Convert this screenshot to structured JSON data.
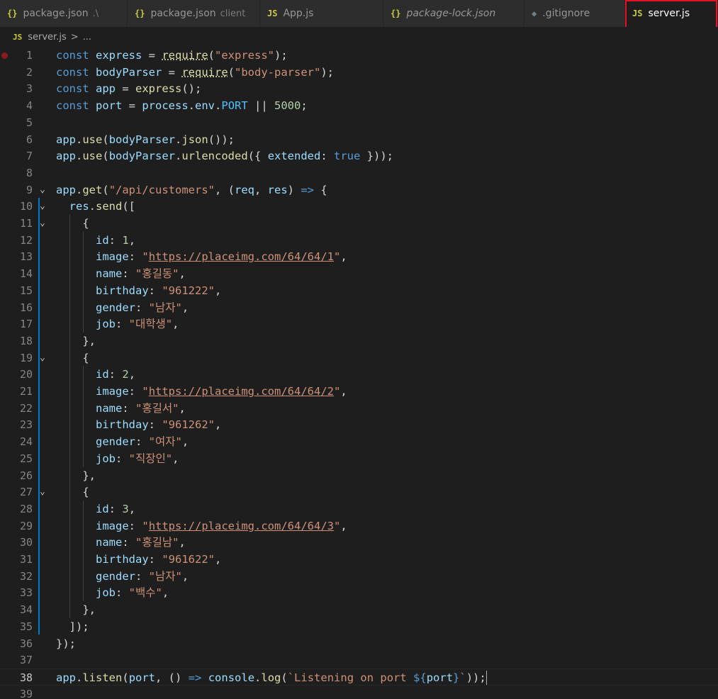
{
  "tabs": [
    {
      "icon": "{}",
      "icon_name": "json-icon",
      "label": "package.json",
      "desc": ".\\",
      "width": 180
    },
    {
      "icon": "{}",
      "icon_name": "json-icon",
      "label": "package.json",
      "desc": "client",
      "width": 187
    },
    {
      "icon": "JS",
      "icon_name": "js-icon",
      "label": "App.js",
      "desc": "",
      "width": 174
    },
    {
      "icon": "{}",
      "icon_name": "json-icon",
      "label": "package-lock.json",
      "desc": "",
      "width": 199,
      "italic": true
    },
    {
      "icon": "◆",
      "icon_name": "git-icon",
      "label": ".gitignore",
      "desc": "",
      "width": 142
    },
    {
      "icon": "JS",
      "icon_name": "js-icon",
      "label": "server.js",
      "desc": "",
      "width": 131,
      "active": true
    }
  ],
  "breadcrumb": {
    "icon": "JS",
    "file": "server.js",
    "separator": ">",
    "more": "..."
  },
  "editor": {
    "active_line": 38,
    "breakpoint_line": 1,
    "lines": [
      {
        "n": 1,
        "code": "const express = require(\"express\");"
      },
      {
        "n": 2,
        "code": "const bodyParser = require(\"body-parser\");"
      },
      {
        "n": 3,
        "code": "const app = express();"
      },
      {
        "n": 4,
        "code": "const port = process.env.PORT || 5000;"
      },
      {
        "n": 5,
        "code": ""
      },
      {
        "n": 6,
        "code": "app.use(bodyParser.json());"
      },
      {
        "n": 7,
        "code": "app.use(bodyParser.urlencoded({ extended: true }));"
      },
      {
        "n": 8,
        "code": ""
      },
      {
        "n": 9,
        "code": "app.get(\"/api/customers\", (req, res) => {",
        "fold": true
      },
      {
        "n": 10,
        "code": "  res.send([",
        "fold": true
      },
      {
        "n": 11,
        "code": "    {",
        "fold": true
      },
      {
        "n": 12,
        "code": "      id: 1,"
      },
      {
        "n": 13,
        "code": "      image: \"https://placeimg.com/64/64/1\","
      },
      {
        "n": 14,
        "code": "      name: \"홍길동\","
      },
      {
        "n": 15,
        "code": "      birthday: \"961222\","
      },
      {
        "n": 16,
        "code": "      gender: \"남자\","
      },
      {
        "n": 17,
        "code": "      job: \"대학생\","
      },
      {
        "n": 18,
        "code": "    },"
      },
      {
        "n": 19,
        "code": "    {",
        "fold": true
      },
      {
        "n": 20,
        "code": "      id: 2,"
      },
      {
        "n": 21,
        "code": "      image: \"https://placeimg.com/64/64/2\","
      },
      {
        "n": 22,
        "code": "      name: \"홍길서\","
      },
      {
        "n": 23,
        "code": "      birthday: \"961262\","
      },
      {
        "n": 24,
        "code": "      gender: \"여자\","
      },
      {
        "n": 25,
        "code": "      job: \"직장인\","
      },
      {
        "n": 26,
        "code": "    },"
      },
      {
        "n": 27,
        "code": "    {",
        "fold": true
      },
      {
        "n": 28,
        "code": "      id: 3,"
      },
      {
        "n": 29,
        "code": "      image: \"https://placeimg.com/64/64/3\","
      },
      {
        "n": 30,
        "code": "      name: \"홍길남\","
      },
      {
        "n": 31,
        "code": "      birthday: \"961622\","
      },
      {
        "n": 32,
        "code": "      gender: \"남자\","
      },
      {
        "n": 33,
        "code": "      job: \"백수\","
      },
      {
        "n": 34,
        "code": "    },"
      },
      {
        "n": 35,
        "code": "  ]);"
      },
      {
        "n": 36,
        "code": "});"
      },
      {
        "n": 37,
        "code": ""
      },
      {
        "n": 38,
        "code": "app.listen(port, () => console.log(`Listening on port ${port}`));"
      },
      {
        "n": 39,
        "code": ""
      }
    ]
  },
  "colors": {
    "background": "#1e1e1e",
    "keyword": "#569cd6",
    "function": "#dcdcaa",
    "variable": "#9cdcfe",
    "string": "#ce9178",
    "number": "#b5cea8",
    "constant": "#4fc1ff",
    "highlight_box": "#e81123"
  }
}
